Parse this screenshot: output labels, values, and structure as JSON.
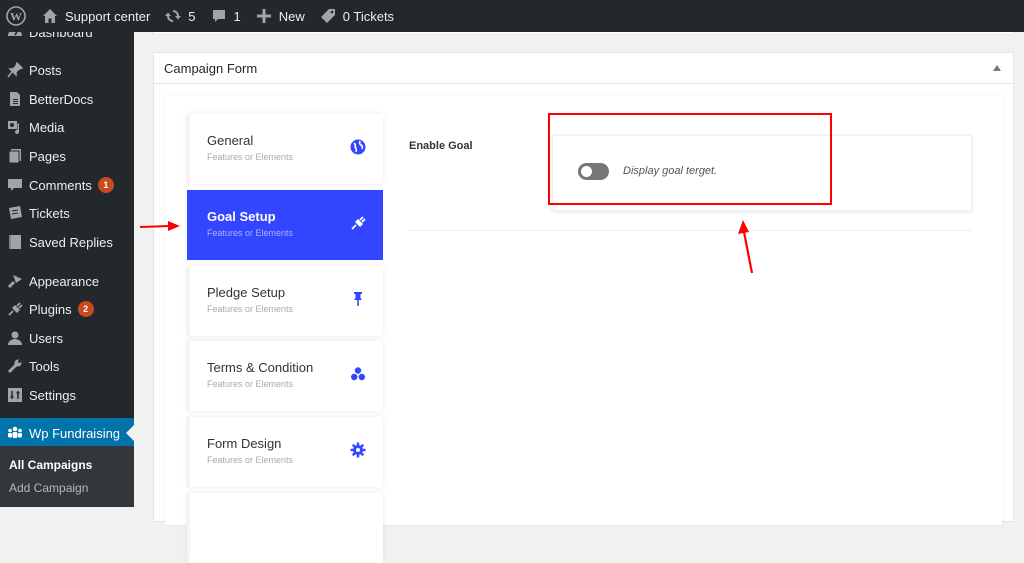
{
  "adminbar": {
    "site_name": "Support center",
    "updates_count": "5",
    "comments_count": "1",
    "new_label": "New",
    "tickets_label": "0 Tickets"
  },
  "sidebar": {
    "items": [
      {
        "label": "Dashboard",
        "icon": "dashboard-icon"
      },
      {
        "label": "Posts",
        "icon": "pin-icon"
      },
      {
        "label": "BetterDocs",
        "icon": "document-icon"
      },
      {
        "label": "Media",
        "icon": "media-icon"
      },
      {
        "label": "Pages",
        "icon": "pages-icon"
      },
      {
        "label": "Comments",
        "icon": "comment-icon",
        "badge": "1"
      },
      {
        "label": "Tickets",
        "icon": "tickets-icon"
      },
      {
        "label": "Saved Replies",
        "icon": "book-icon"
      },
      {
        "label": "Appearance",
        "icon": "brush-icon"
      },
      {
        "label": "Plugins",
        "icon": "plugin-icon",
        "badge": "2"
      },
      {
        "label": "Users",
        "icon": "user-icon"
      },
      {
        "label": "Tools",
        "icon": "wrench-icon"
      },
      {
        "label": "Settings",
        "icon": "settings-icon"
      },
      {
        "label": "Wp Fundraising",
        "icon": "group-icon",
        "active": true
      }
    ],
    "submenu": [
      {
        "label": "All Campaigns",
        "current": true
      },
      {
        "label": "Add Campaign"
      }
    ]
  },
  "main": {
    "postbox_title": "Campaign Form",
    "tabs": [
      {
        "title": "General",
        "subtitle": "Features or Elements",
        "icon": "globe-icon"
      },
      {
        "title": "Goal Setup",
        "subtitle": "Features or Elements",
        "icon": "plug-icon",
        "active": true
      },
      {
        "title": "Pledge Setup",
        "subtitle": "Features or Elements",
        "icon": "thumbtack-icon"
      },
      {
        "title": "Terms & Condition",
        "subtitle": "Features or Elements",
        "icon": "cubes-icon"
      },
      {
        "title": "Form Design",
        "subtitle": "Features or Elements",
        "icon": "gear-icon"
      }
    ],
    "field": {
      "label": "Enable Goal",
      "toggle_state": "off",
      "toggle_description": "Display goal terget."
    }
  },
  "colors": {
    "accent": "#3346ff",
    "admin_dark": "#23282d",
    "admin_active": "#0073aa",
    "badge": "#ca4a1f",
    "annotation": "#ff0000"
  }
}
